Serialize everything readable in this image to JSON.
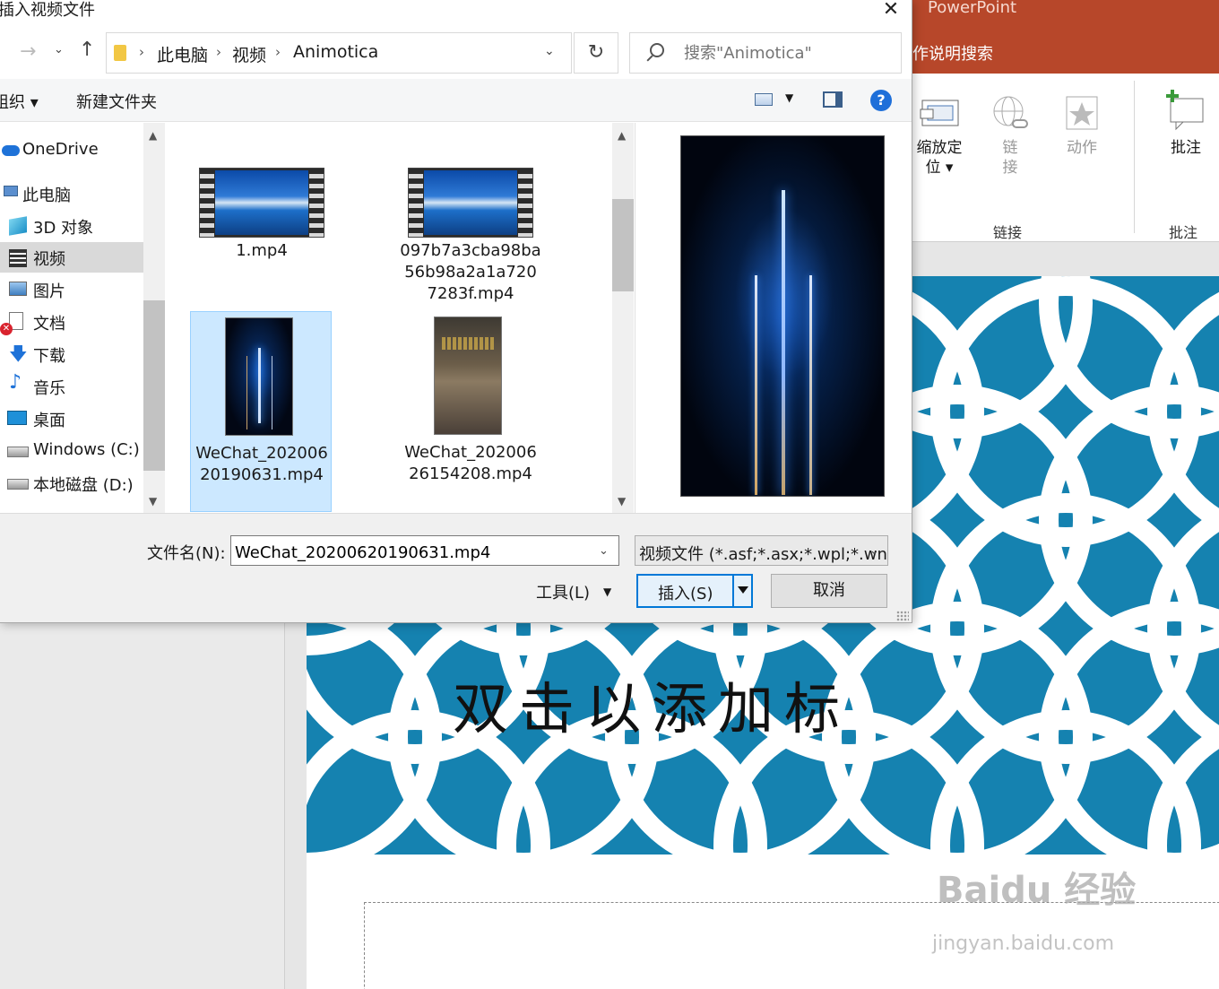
{
  "dialog": {
    "title": "插入视频文件",
    "close_glyph": "✕",
    "nav": {
      "back": "→",
      "recent": "⌄",
      "up": "↑"
    },
    "breadcrumbs": [
      "此电脑",
      "视频",
      "Animotica"
    ],
    "crumb_sep": "›",
    "refresh_glyph": "↻",
    "search_placeholder": "搜索\"Animotica\"",
    "toolbar": {
      "organize": "组织 ▾",
      "new_folder": "新建文件夹",
      "help": "?"
    },
    "nav_pane": [
      {
        "label": "OneDrive",
        "icon": "cloud-icon"
      },
      {
        "label": "此电脑",
        "icon": "computer-icon"
      },
      {
        "label": "3D 对象",
        "icon": "cube-icon"
      },
      {
        "label": "视频",
        "icon": "film-icon",
        "selected": true
      },
      {
        "label": "图片",
        "icon": "picture-icon"
      },
      {
        "label": "文档",
        "icon": "document-icon"
      },
      {
        "label": "下载",
        "icon": "download-icon"
      },
      {
        "label": "音乐",
        "icon": "music-icon"
      },
      {
        "label": "桌面",
        "icon": "desktop-icon"
      },
      {
        "label": "Windows (C:)",
        "icon": "drive-icon"
      },
      {
        "label": "本地磁盘 (D:)",
        "icon": "drive-icon"
      }
    ],
    "files": [
      {
        "name": "1.mp4",
        "thumb": "landscape-film"
      },
      {
        "name": "097b7a3cba98ba56b98a2a1a7207283f.mp4",
        "thumb": "landscape-film"
      },
      {
        "name": "WeChat_20200620190631.mp4",
        "thumb": "portrait-dark",
        "selected": true
      },
      {
        "name": "WeChat_20200626154208.mp4",
        "thumb": "portrait-brown"
      }
    ],
    "footer": {
      "filename_label": "文件名(N):",
      "filename_value": "WeChat_20200620190631.mp4",
      "filetype_value": "视频文件 (*.asf;*.asx;*.wpl;*.wn",
      "tools_label": "工具(L)",
      "insert_label": "插入(S)",
      "cancel_label": "取消"
    }
  },
  "powerpoint": {
    "title": "PowerPoint",
    "tell_me": "作说明搜索",
    "ribbon": {
      "zoom_label": "缩放定\n位 ▾",
      "link_label": "链\n接",
      "action_label": "动作",
      "comment_label": "批注",
      "group_links": "链接",
      "group_comments": "批注"
    },
    "slide_title": "双击以添加标",
    "colors": {
      "accent": "#b7472a",
      "slide_pattern": "#1582b0"
    }
  },
  "watermark": {
    "main": "Baidu 经验",
    "sub": "jingyan.baidu.com"
  }
}
